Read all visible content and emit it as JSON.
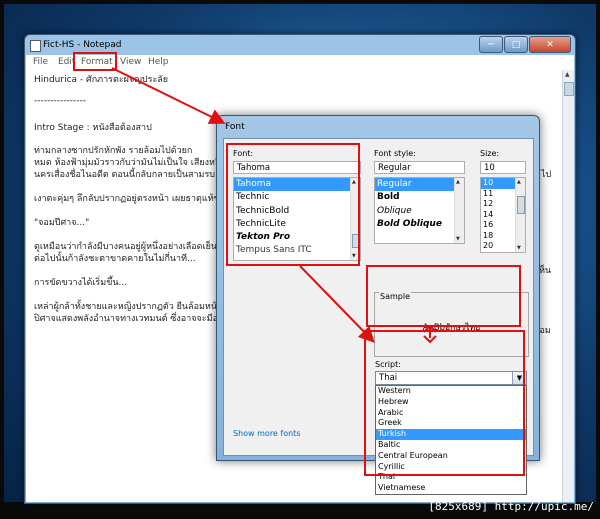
{
  "notepad": {
    "title": "Fict-HS - Notepad",
    "caption": {
      "min": "─",
      "max": "□",
      "close": "✕"
    },
    "menu": [
      "File",
      "Edit",
      "Format",
      "View",
      "Help"
    ],
    "lines": [
      "Hindurica - ศักภารตะผจญประลัย",
      "----------------",
      "Intro Stage : หนังสือต้องสาป",
      "          ท่ามกลางซากปรักหักพัง รายล้อมไปด้วยก",
      "หมด ห้องฟ้ามุ่มมัวราวกับว่ามันไม่เป็นใจ เสียงหวีดร้",
      "นครเสื่องชื่อไนอดีต ตอนนี้กลับกลายเป็นสามรบ",
      "เงาตะคุ่มๆ ลึกลับปรากฏอยู่ตรงหน้า เผยธาตุแท้ของ",
      "\"จอมปีศาจ...\"",
      "ดูเหมือนว่ากำลังมีบางคนอยู่ผู้หนึ่งอย่างเลือดเย็น",
      "ต่อไปนั้นก้าลังชะตาขาดคายในไม่กี่นาที...",
      "การขัดขวางได้เริ่มขึ้น...",
      "เหล่าผู้กล้าทั้งชายและหญิงปรากฏตัว ยืนล้อมหน้า",
      "ปิศาจแสดงพลังอำนาจทางเวทมนต์ ซึ่งอาจจะมีอา"
    ],
    "right_fragments": [
      "ไป",
      "เห็น",
      "ล้อม"
    ]
  },
  "font_dialog": {
    "title": "Font",
    "font_label": "Font:",
    "font_value": "Tahoma",
    "fonts": [
      "Tahoma",
      "Technic",
      "TechnicBold",
      "TechnicLite",
      "Tekton Pro",
      "Tempus Sans ITC"
    ],
    "selected_font_index": 0,
    "style_label": "Font style:",
    "style_value": "Regular",
    "styles": [
      "Regular",
      "Bold",
      "Oblique",
      "Bold Oblique"
    ],
    "size_label": "Size:",
    "size_value": "10",
    "sizes": [
      "10",
      "11",
      "12",
      "14",
      "16",
      "18",
      "20"
    ],
    "sample_label": "Sample",
    "sample_text": "AaBbอักษรไทย",
    "script_label": "Script:",
    "script_value": "Thai",
    "scripts": [
      "Western",
      "Hebrew",
      "Arabic",
      "Greek",
      "Turkish",
      "Baltic",
      "Central European",
      "Cyrillic",
      "Thai",
      "Vietnamese"
    ],
    "selected_script_index": 4,
    "show_more_link": "Show more fonts"
  },
  "footer": "[825x689] http://upic.me/",
  "colors": {
    "annotation": "#e01010",
    "selection": "#3399ff",
    "link": "#0066cc"
  }
}
